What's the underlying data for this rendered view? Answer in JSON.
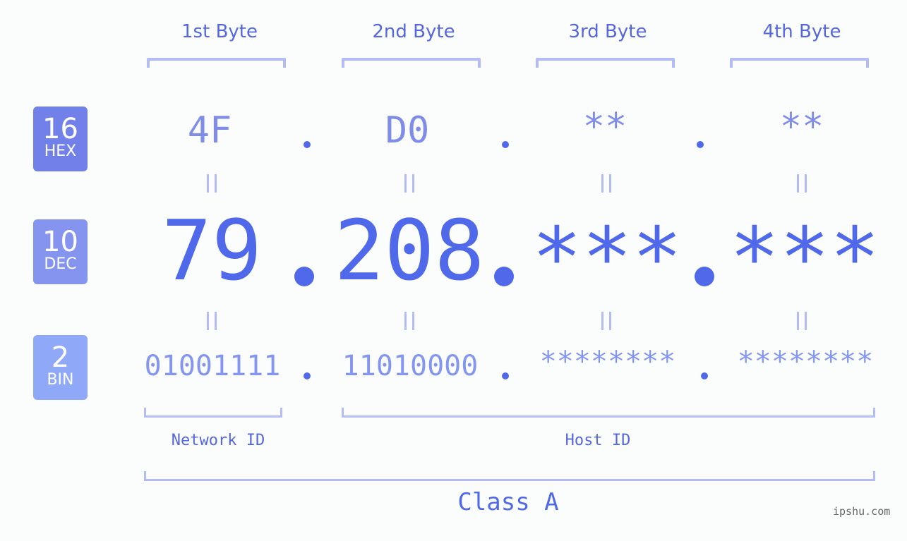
{
  "byte_headers": [
    "1st Byte",
    "2nd Byte",
    "3rd Byte",
    "4th Byte"
  ],
  "badges": {
    "hex": {
      "number": "16",
      "label": "HEX",
      "color": "#7281ea"
    },
    "dec": {
      "number": "10",
      "label": "DEC",
      "color": "#8494ef"
    },
    "bin": {
      "number": "2",
      "label": "BIN",
      "color": "#8fa8f8"
    }
  },
  "hex": [
    "4F",
    "D0",
    "**",
    "**"
  ],
  "dec": [
    "79",
    "208",
    "***",
    "***"
  ],
  "bin": [
    "01001111",
    "11010000",
    "********",
    "********"
  ],
  "separator": ".",
  "segments": {
    "network_id": "Network ID",
    "host_id": "Host ID",
    "class_label": "Class A"
  },
  "watermark": "ipshu.com",
  "colors": {
    "accent": "#5068ea",
    "bracket": "#b3bcf5",
    "background": "#fbfdfc"
  }
}
